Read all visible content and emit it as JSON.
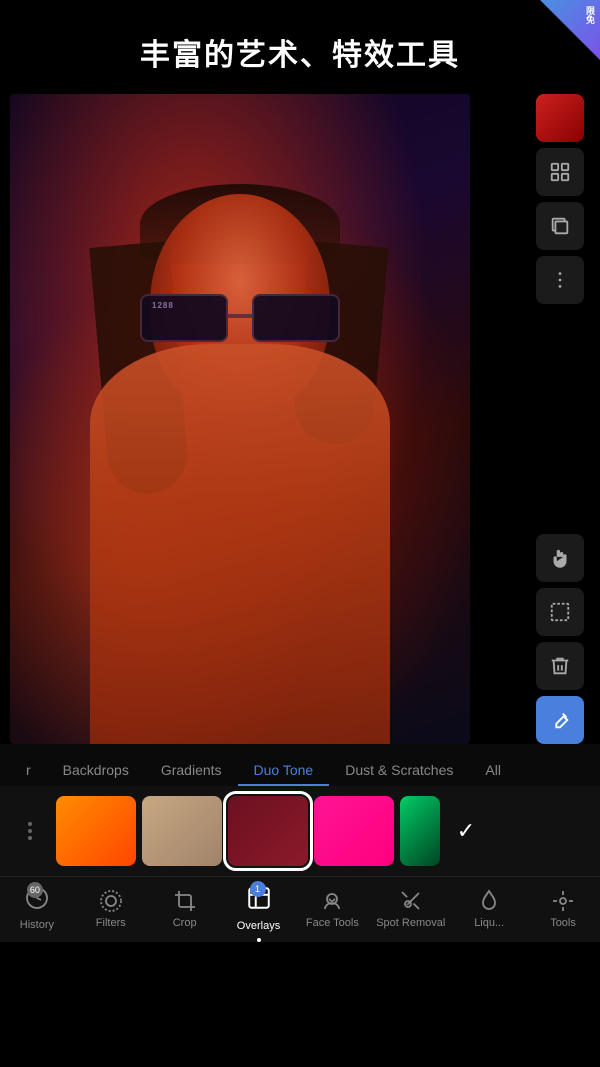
{
  "header": {
    "title": "丰富的艺术、特效工具",
    "badge_text": "限免"
  },
  "toolbar_right": {
    "tools": [
      {
        "id": "color-swatch",
        "label": "color swatch",
        "type": "swatch"
      },
      {
        "id": "mosaic",
        "label": "mosaic",
        "icon": "⊞"
      },
      {
        "id": "layers",
        "label": "layers",
        "icon": "◱"
      },
      {
        "id": "more",
        "label": "more options",
        "icon": "⋮"
      },
      {
        "id": "hand",
        "label": "hand tool",
        "icon": "✋"
      },
      {
        "id": "crop-tool",
        "label": "crop tool",
        "icon": "⊡"
      },
      {
        "id": "delete",
        "label": "delete",
        "icon": "🗑"
      },
      {
        "id": "pen",
        "label": "pen tool",
        "icon": "✏",
        "active": true
      }
    ]
  },
  "overlay_tabs": {
    "items": [
      {
        "id": "tab-r",
        "label": "r",
        "active": false
      },
      {
        "id": "tab-backdrops",
        "label": "Backdrops",
        "active": false
      },
      {
        "id": "tab-gradients",
        "label": "Gradients",
        "active": false
      },
      {
        "id": "tab-duotone",
        "label": "Duo Tone",
        "active": true
      },
      {
        "id": "tab-dust",
        "label": "Dust & Scratches",
        "active": false
      },
      {
        "id": "tab-all",
        "label": "All",
        "active": false
      }
    ]
  },
  "swatches": {
    "items": [
      {
        "id": "swatch-orange",
        "type": "orange",
        "selected": false
      },
      {
        "id": "swatch-tan",
        "type": "tan",
        "selected": false
      },
      {
        "id": "swatch-dark-red",
        "type": "dark-red",
        "selected": true
      },
      {
        "id": "swatch-pink",
        "type": "pink",
        "selected": false
      },
      {
        "id": "swatch-green",
        "type": "green",
        "selected": false
      }
    ]
  },
  "bottom_toolbar": {
    "tools": [
      {
        "id": "history",
        "label": "History",
        "badge": "60",
        "active": false
      },
      {
        "id": "filters",
        "label": "Filters",
        "active": false
      },
      {
        "id": "crop",
        "label": "Crop",
        "active": false
      },
      {
        "id": "overlays",
        "label": "Overlays",
        "active": true,
        "badge_num": "1"
      },
      {
        "id": "face-tools",
        "label": "Face Tools",
        "active": false
      },
      {
        "id": "spot-removal",
        "label": "Spot Removal",
        "active": false
      },
      {
        "id": "liquify",
        "label": "Liqu...",
        "active": false
      },
      {
        "id": "tools",
        "label": "Tools",
        "active": false
      }
    ]
  }
}
